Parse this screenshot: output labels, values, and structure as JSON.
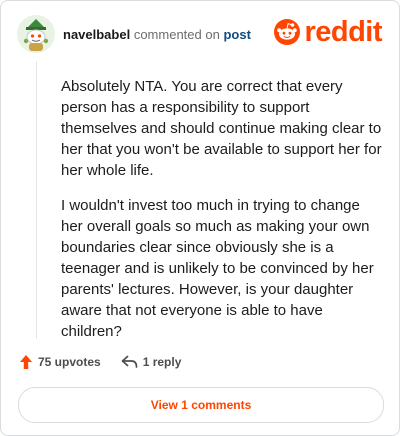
{
  "comment": {
    "username": "navelbabel",
    "verb": "commented on",
    "post_link": "post",
    "paragraphs": [
      "Absolutely NTA. You are correct that every person has a responsibility to support themselves and should continue making clear to her that you won't be available to support her for her whole life.",
      "I wouldn't invest too much in trying to change her overall goals so much as making your own boundaries clear since obviously she is a teenager and is unlikely to be convinced by her parents' lectures. However, is your daughter aware that not everyone is able to have children?"
    ]
  },
  "brand": {
    "wordmark": "reddit",
    "color": "#ff4500"
  },
  "actions": {
    "upvotes": "75 upvotes",
    "reply": "1 reply",
    "upvote_icon": "upvote-arrow-icon",
    "reply_icon": "reply-arrow-icon"
  },
  "footer": {
    "view_comments": "View 1 comments"
  },
  "colors": {
    "accent": "#ff4500",
    "link": "#0f4c81",
    "muted": "#6a6d70",
    "border": "#d9dcdf"
  }
}
